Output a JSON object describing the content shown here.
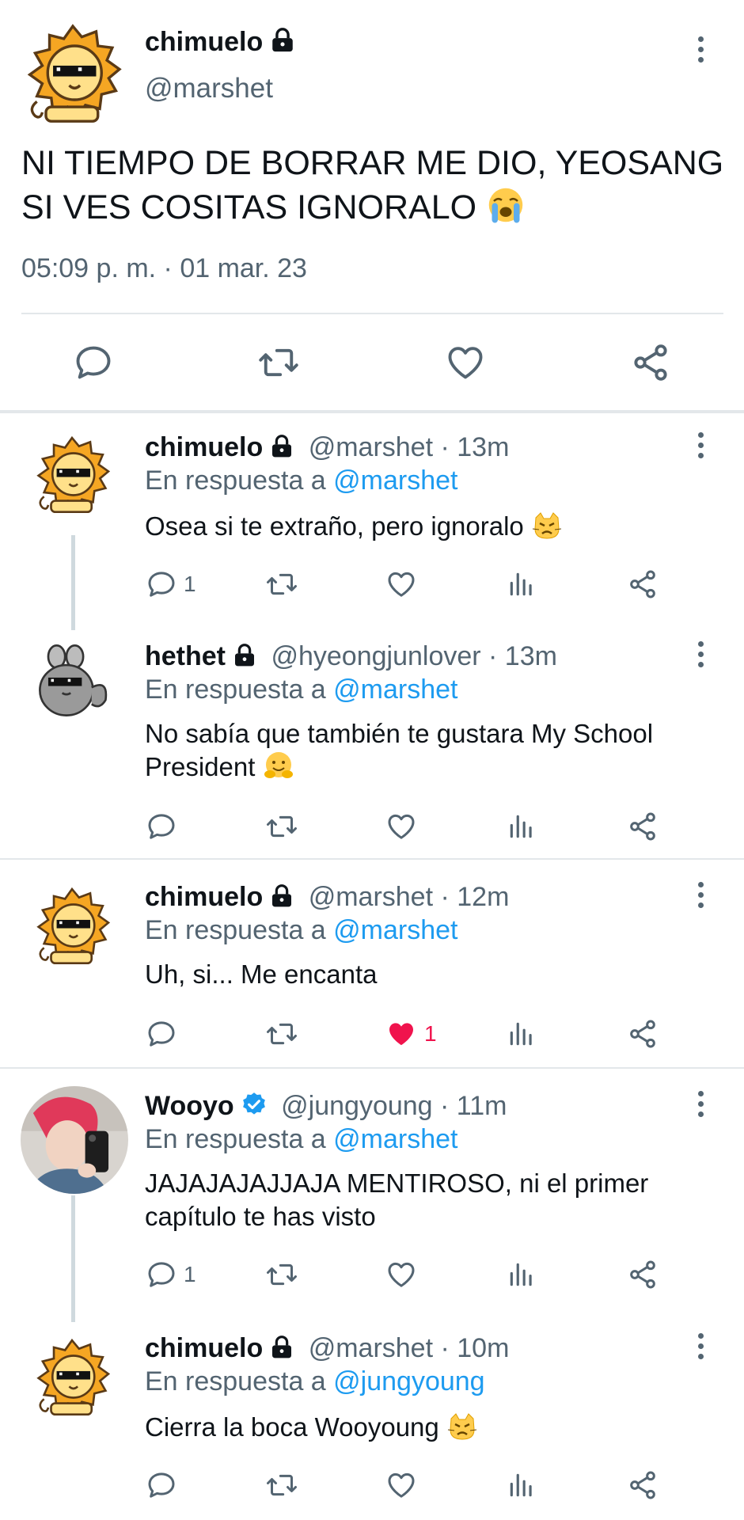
{
  "main_tweet": {
    "name": "chimuelo",
    "handle": "@marshet",
    "text": "NI TIEMPO DE BORRAR ME DIO, YEOSANG SI VES COSITAS IGNORALO",
    "emoji": "loudly-crying-face",
    "timestamp": "05:09 p. m. · 01 mar. 23",
    "actions": [
      "reply-icon",
      "retweet-icon",
      "like-icon",
      "share-icon"
    ]
  },
  "replies": [
    {
      "name": "chimuelo",
      "handle": "@marshet · 13m",
      "reply_prefix": "En respuesta a ",
      "reply_to": "@marshet",
      "text": "Osea si te extraño, pero ignoralo",
      "emoji": "pouting-cat-face",
      "reply_count": "1",
      "like_count": "",
      "liked": false
    },
    {
      "name": "hethet",
      "handle": "@hyeongjunlover · 13m",
      "reply_prefix": "En respuesta a ",
      "reply_to": "@marshet",
      "text": "No sabía que también te gustara My School President",
      "emoji": "hugging-face",
      "reply_count": "",
      "like_count": "",
      "liked": false
    },
    {
      "name": "chimuelo",
      "handle": "@marshet · 12m",
      "reply_prefix": "En respuesta a ",
      "reply_to": "@marshet",
      "text": "Uh, si... Me encanta",
      "reply_count": "",
      "like_count": "1",
      "liked": true
    },
    {
      "name": "Wooyo",
      "verified": true,
      "handle": "@jungyoung · 11m",
      "reply_prefix": "En respuesta a ",
      "reply_to": "@marshet",
      "text": "JAJAJAJAJJAJA MENTIROSO, ni el primer capítulo te has visto",
      "reply_count": "1",
      "like_count": "",
      "liked": false
    },
    {
      "name": "chimuelo",
      "handle": "@marshet · 10m",
      "reply_prefix": "En respuesta a ",
      "reply_to": "@jungyoung",
      "text": "Cierra la boca Wooyoung",
      "emoji": "pouting-cat-face",
      "reply_count": "",
      "like_count": "",
      "liked": false
    }
  ],
  "colors": {
    "text": "#0f1419",
    "secondary": "#536471",
    "link": "#1d9bf0",
    "like_active": "#f91880",
    "divider": "#e3e7ea"
  }
}
